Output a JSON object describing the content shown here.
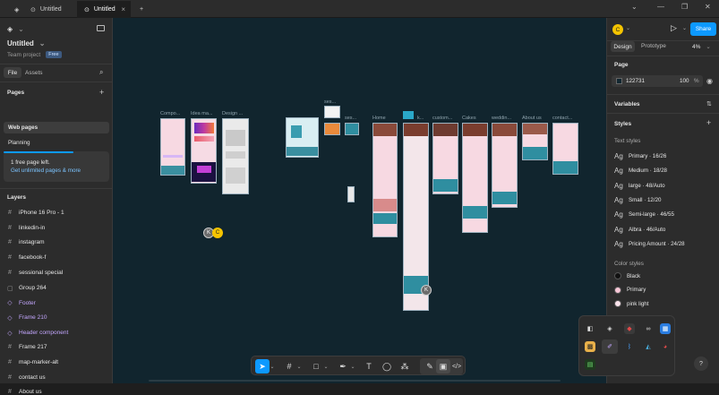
{
  "tabs": [
    {
      "label": "Untitled"
    },
    {
      "label": "Untitled"
    }
  ],
  "file": {
    "name": "Untitled",
    "team": "Team project",
    "plan": "Free"
  },
  "left_tabs": {
    "file": "File",
    "assets": "Assets"
  },
  "pages": {
    "title": "Pages",
    "items": [
      "Web pages",
      "Planning"
    ]
  },
  "upgrade": {
    "text": "1 free page left.",
    "link": "Get unlimited pages & more"
  },
  "layers": {
    "title": "Layers",
    "items": [
      {
        "label": "iPhone 16 Pro - 1",
        "type": "frame"
      },
      {
        "label": "linkedin-in",
        "type": "frame"
      },
      {
        "label": "instagram",
        "type": "frame"
      },
      {
        "label": "facebook-f",
        "type": "frame"
      },
      {
        "label": "sessional special",
        "type": "frame"
      },
      {
        "label": "Group 264",
        "type": "group"
      },
      {
        "label": "Footer",
        "type": "component"
      },
      {
        "label": "Frame 210",
        "type": "component"
      },
      {
        "label": "Header component",
        "type": "component"
      },
      {
        "label": "Frame 217",
        "type": "frame"
      },
      {
        "label": "map-marker-alt",
        "type": "frame"
      },
      {
        "label": "contact us",
        "type": "frame"
      },
      {
        "label": "About us",
        "type": "frame"
      }
    ]
  },
  "canvas": {
    "labels": [
      "Compo...",
      "Idea ma...",
      "Design ...",
      "ses...",
      "ses...",
      "Home",
      "k...",
      "custom...",
      "Cakes",
      "weddin...",
      "About us",
      "contact..."
    ],
    "cursors": [
      "K",
      "C",
      "K"
    ]
  },
  "header": {
    "avatar": "C",
    "share": "Share",
    "design_tab": "Design",
    "prototype_tab": "Prototype",
    "zoom": "4%"
  },
  "page_panel": {
    "title": "Page",
    "color_hex": "122731",
    "opacity": "100",
    "unit": "%",
    "color": "#122731"
  },
  "variables": {
    "title": "Variables"
  },
  "styles": {
    "title": "Styles",
    "text_title": "Text styles",
    "text_styles": [
      "Primary · 16/26",
      "Medium · 18/28",
      "large · 48/Auto",
      "Small · 12/20",
      "Semi-large · 46/55",
      "Albra · 46/Auto",
      "Pricing Amount · 24/28"
    ],
    "color_title": "Color styles",
    "colors": [
      {
        "name": "Black",
        "hex": "#111111"
      },
      {
        "name": "Primary",
        "hex": "#f7c6d6"
      },
      {
        "name": "pink light",
        "hex": "#fbe3ec"
      }
    ]
  },
  "help": "?"
}
